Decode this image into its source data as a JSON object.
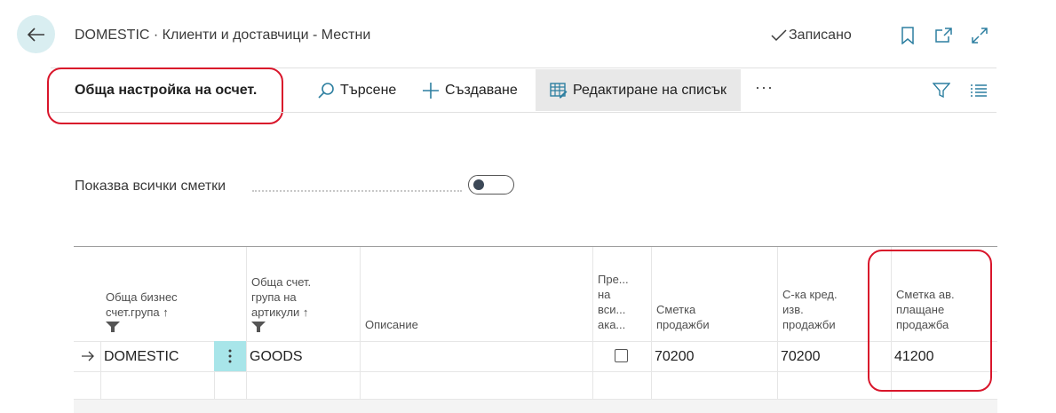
{
  "header": {
    "breadcrumb": "DOMESTIC · Клиенти и доставчици - Местни",
    "status": "Записано"
  },
  "page": {
    "title": "Обща настройка на осчет."
  },
  "actions": {
    "search_label": "Търсене",
    "create_label": "Създаване",
    "edit_list_label": "Редактиране на списък",
    "more_label": "···"
  },
  "filters": {
    "show_all_label": "Показва всички сметки",
    "show_all_on": false
  },
  "table": {
    "columns": [
      {
        "line1": "Обща бизнес",
        "line2": "счет.група ↑",
        "line3": "",
        "line4": ""
      },
      {
        "line1": "Обща счет.",
        "line2": "група на",
        "line3": "артикули ↑",
        "line4": ""
      },
      {
        "line1": "Описание",
        "line2": "",
        "line3": "",
        "line4": ""
      },
      {
        "line1": "Пре...",
        "line2": "на",
        "line3": "вси...",
        "line4": "ака..."
      },
      {
        "line1": "Сметка",
        "line2": "продажби",
        "line3": "",
        "line4": ""
      },
      {
        "line1": "С-ка кред.",
        "line2": "изв.",
        "line3": "продажби",
        "line4": ""
      },
      {
        "line1": "Сметка ав.",
        "line2": "плащане",
        "line3": "продажба",
        "line4": ""
      }
    ],
    "rows": [
      {
        "business_group": "DOMESTIC",
        "product_group": "GOODS",
        "description": "",
        "show_all": false,
        "sales_account": "70200",
        "sales_credit_memo": "70200",
        "sales_prepayment": "41200"
      }
    ]
  },
  "colors": {
    "accent": "#a8e5e9",
    "back_button_bg": "#d9eef1",
    "annotation_red": "#d9162b",
    "edit_button_bg": "#e8e8e8"
  },
  "icons": {
    "back": "arrow-left-icon",
    "saved": "checkmark-icon",
    "bookmark": "bookmark-icon",
    "open_new": "open-in-new-window-icon",
    "expand": "expand-icon",
    "search": "search-icon",
    "create": "plus-icon",
    "edit_list": "edit-grid-icon",
    "filter": "filter-icon",
    "list_view": "list-view-icon"
  }
}
